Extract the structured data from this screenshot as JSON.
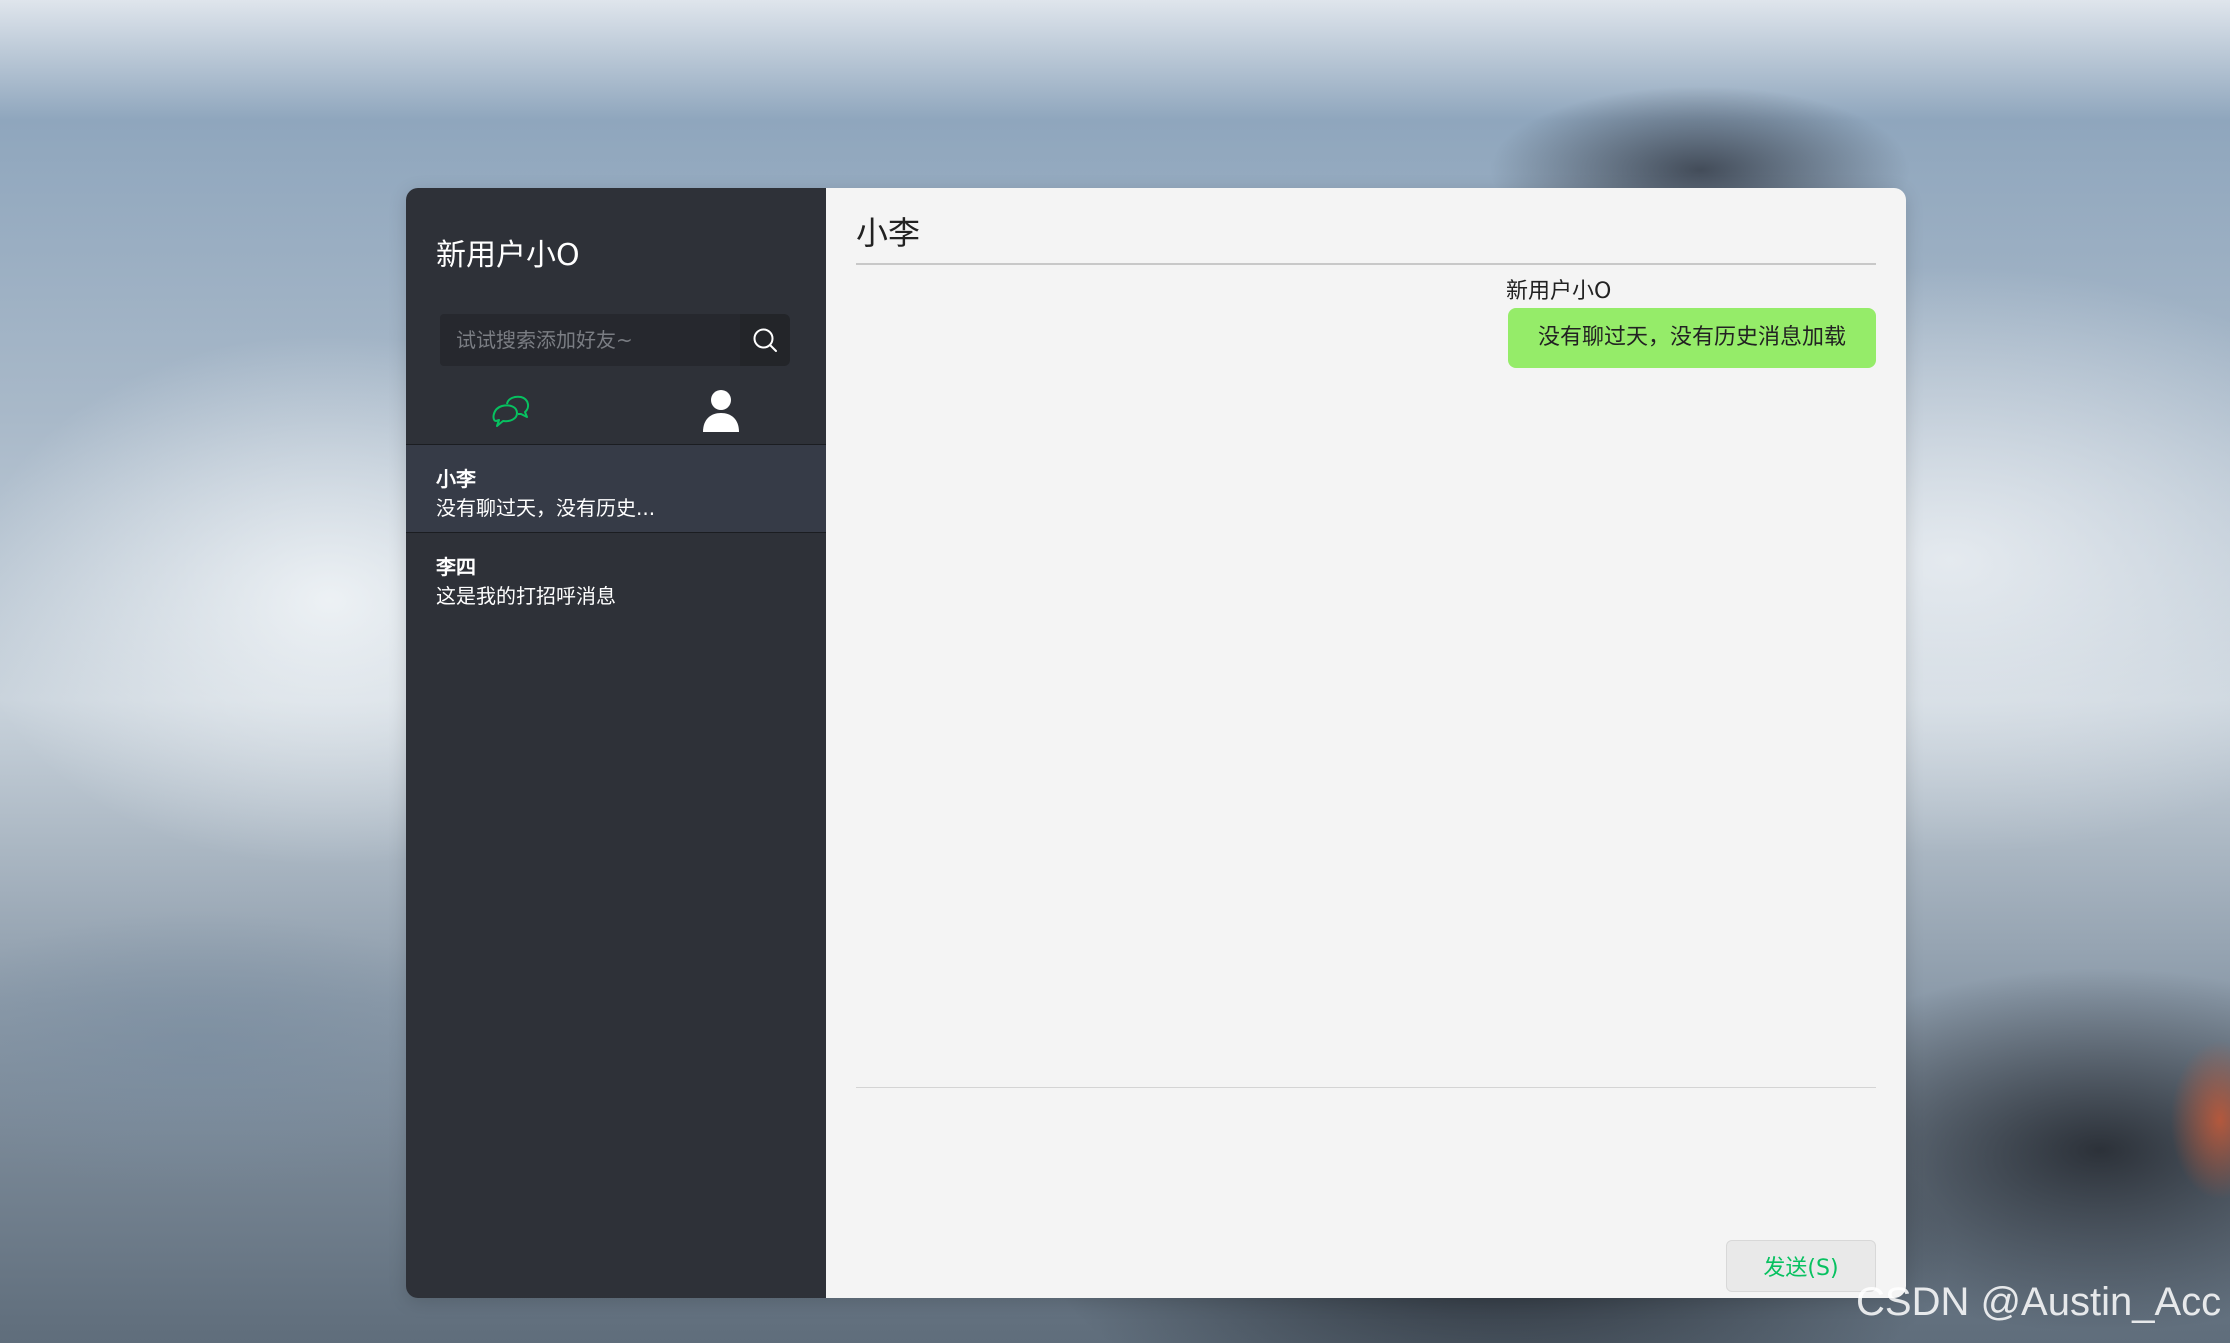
{
  "sidebar": {
    "user_name": "新用户小O",
    "search": {
      "placeholder": "试试搜索添加好友~",
      "value": ""
    },
    "tabs": [
      {
        "icon": "chat-bubbles-icon",
        "active": true
      },
      {
        "icon": "contacts-person-icon",
        "active": false
      }
    ],
    "contacts": [
      {
        "name": "小李",
        "last_message": "没有聊过天，没有历史...",
        "active": true
      },
      {
        "name": "李四",
        "last_message": "这是我的打招呼消息",
        "active": false
      }
    ]
  },
  "chat": {
    "title": "小李",
    "messages": [
      {
        "sender": "新用户小O",
        "text": "没有聊过天，没有历史消息加载",
        "side": "right"
      }
    ],
    "compose": {
      "value": ""
    },
    "send_label": "发送(S)"
  },
  "watermark": "CSDN @Austin_Acc",
  "colors": {
    "sidebar_bg": "#2e3138",
    "active_contact_bg": "#363b47",
    "chat_bg": "#f4f4f4",
    "bubble_bg": "#95ec69",
    "accent_green": "#07c160"
  }
}
